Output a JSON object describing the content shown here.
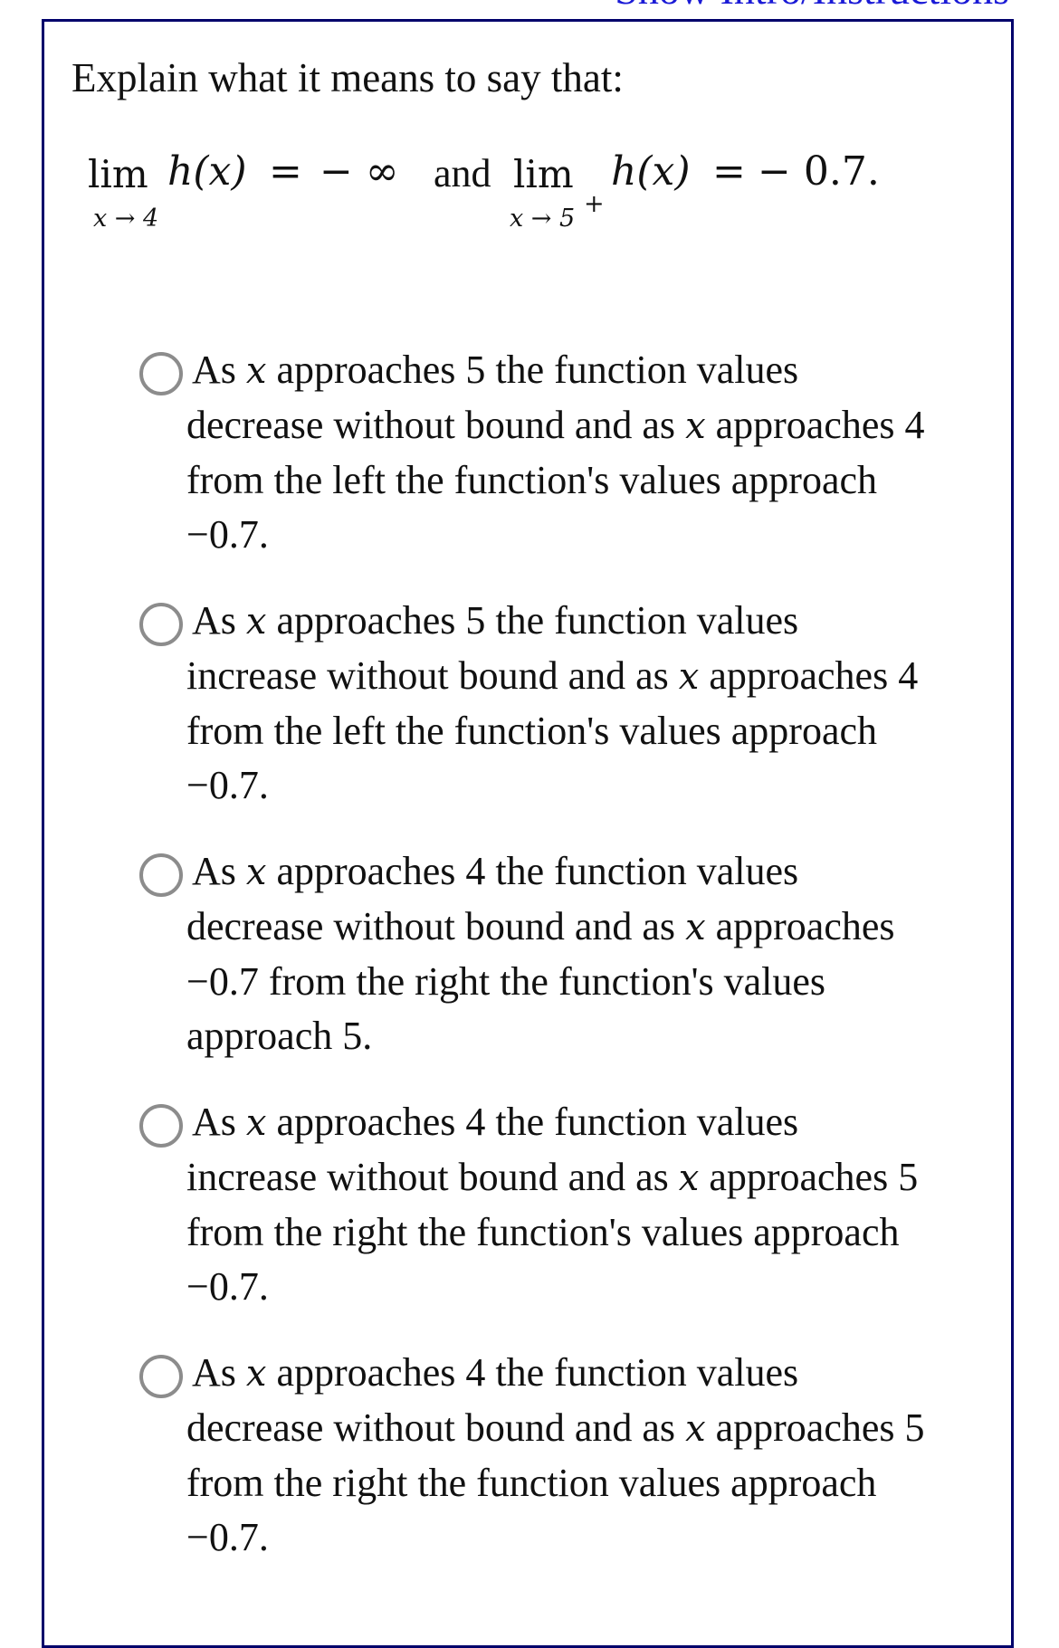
{
  "header": {
    "intro_link": "Show Intro/Instructions"
  },
  "question": {
    "prompt": "Explain what it means to say that:",
    "limit1": {
      "operator": "lim",
      "subscript": "x → 4",
      "function": "h(x)",
      "equals": "=",
      "value": "− ∞"
    },
    "conjunction": "and",
    "limit2": {
      "operator": "lim",
      "subscript": "x → 5",
      "subscript_sup": "+",
      "function": "h(x)",
      "equals": "=",
      "value": "− 0.7."
    }
  },
  "options": [
    {
      "selected": false,
      "lines": [
        [
          "As ",
          "x",
          " approaches 5 the function values"
        ],
        [
          "decrease without bound and as ",
          "x",
          " approaches 4"
        ],
        [
          "from the left the function's values approach"
        ],
        [
          "−0.7."
        ]
      ]
    },
    {
      "selected": false,
      "lines": [
        [
          "As ",
          "x",
          " approaches 5 the function values"
        ],
        [
          "increase without bound and as ",
          "x",
          " approaches 4"
        ],
        [
          "from the left the function's values approach"
        ],
        [
          "−0.7."
        ]
      ]
    },
    {
      "selected": false,
      "lines": [
        [
          "As ",
          "x",
          " approaches 4 the function values"
        ],
        [
          "decrease without bound and as ",
          "x",
          " approaches"
        ],
        [
          "−0.7 from the right the function's values"
        ],
        [
          "approach 5."
        ]
      ]
    },
    {
      "selected": false,
      "lines": [
        [
          "As ",
          "x",
          " approaches 4 the function values"
        ],
        [
          "increase without bound and as ",
          "x",
          " approaches 5"
        ],
        [
          "from the right the function's values approach"
        ],
        [
          "−0.7."
        ]
      ]
    },
    {
      "selected": false,
      "lines": [
        [
          "As ",
          "x",
          " approaches 4 the function values"
        ],
        [
          "decrease without bound and as ",
          "x",
          " approaches 5"
        ],
        [
          "from the right the function values approach"
        ],
        [
          "−0.7."
        ]
      ]
    }
  ]
}
